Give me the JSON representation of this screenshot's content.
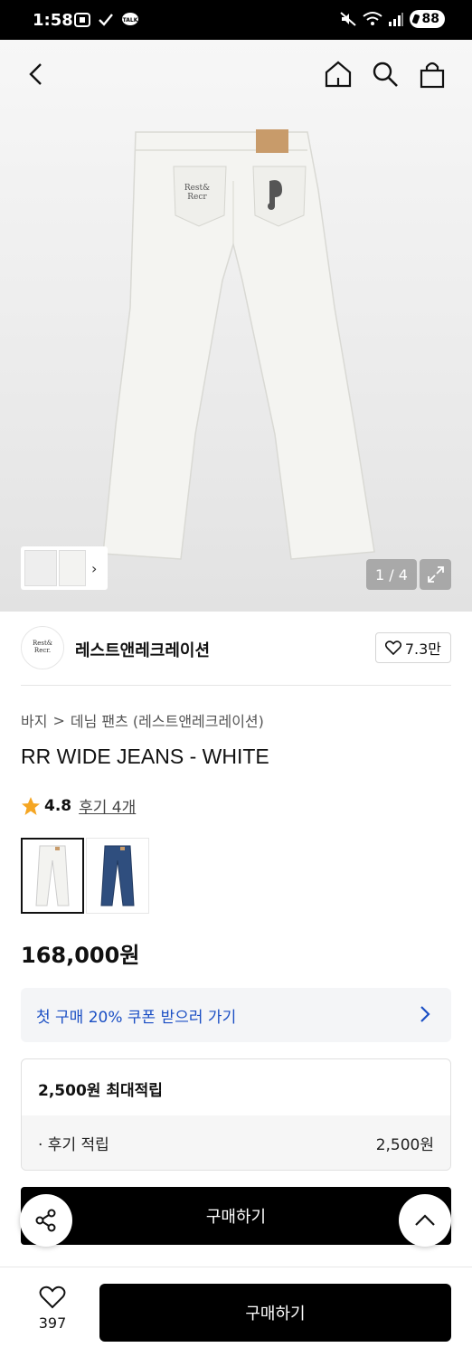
{
  "status_bar": {
    "time": "1:58",
    "battery": "88"
  },
  "gallery": {
    "counter": "1 / 4",
    "thumb_chevron": "›"
  },
  "brand": {
    "name": "레스트앤레크레이션",
    "likes": "7.3만",
    "logo_text": "Rest & Recreation"
  },
  "breadcrumb": {
    "category": "바지",
    "separator": ">",
    "subcategory": "데님 팬츠 (레스트앤레크레이션)"
  },
  "product": {
    "title": "RR WIDE JEANS - WHITE",
    "rating": "4.8",
    "reviews": "후기 4개",
    "price": "168,000원"
  },
  "swatches": [
    {
      "color": "white",
      "selected": true
    },
    {
      "color": "blue",
      "selected": false
    }
  ],
  "coupon": {
    "label": "첫 구매 20% 쿠폰 받으러 가기"
  },
  "points": {
    "header": "2,500원 최대적립",
    "row_label": "· 후기 적립",
    "row_value": "2,500원"
  },
  "buttons": {
    "buy_inline": "구매하기",
    "buy_main": "구매하기"
  },
  "wishlist": {
    "count": "397"
  },
  "colors": {
    "accent_link": "#1b4fc4",
    "star": "#f5a623",
    "primary_button": "#000000"
  }
}
